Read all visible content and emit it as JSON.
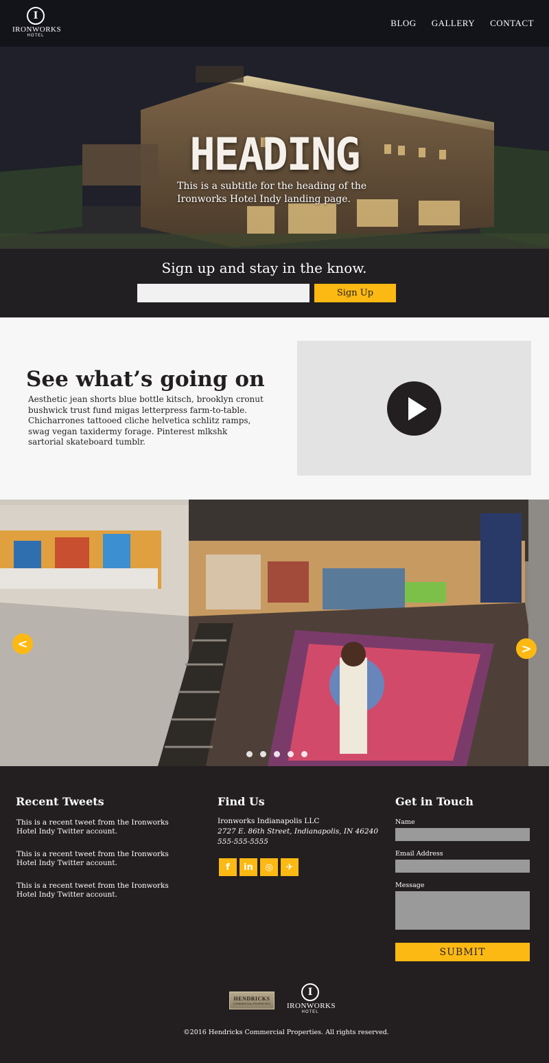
{
  "header": {
    "logo": {
      "name": "IRONWORKS",
      "sub": "HOTEL",
      "badge": "I"
    },
    "nav": [
      "BLOG",
      "GALLERY",
      "CONTACT"
    ]
  },
  "hero": {
    "heading": "HEADING",
    "subtitle": "This is a subtitle for the heading of the Ironworks Hotel Indy landing page.",
    "signup_title": "Sign up and stay in the know.",
    "signup_input_value": "",
    "signup_button": "Sign Up"
  },
  "info": {
    "title": "See what’s going on",
    "text": "Aesthetic jean shorts blue bottle kitsch, brooklyn cronut bushwick trust fund migas letterpress farm-to-table. Chicharrones tattooed cliche helvetica schlitz ramps, swag vegan taxidermy forage. Pinterest mlkshk sartorial skateboard tumblr."
  },
  "carousel": {
    "prev_glyph": "<",
    "next_glyph": ">",
    "slide_count": 5,
    "active_slide": 3
  },
  "footer": {
    "tweets_title": "Recent Tweets",
    "tweets": [
      "This is a recent tweet from the Ironworks Hotel Indy Twitter account.",
      "This is a recent tweet from the Ironworks Hotel Indy Twitter account.",
      "This is a recent tweet from the Ironworks Hotel Indy Twitter account."
    ],
    "find_title": "Find Us",
    "company": "Ironworks Indianapolis LLC",
    "address": "2727 E. 86th Street, Indianapolis, IN 46240",
    "phone": "555-555-5555",
    "socials": [
      {
        "name": "facebook-icon",
        "glyph": "f"
      },
      {
        "name": "linkedin-icon",
        "glyph": "in"
      },
      {
        "name": "instagram-icon",
        "glyph": "◎"
      },
      {
        "name": "twitter-icon",
        "glyph": "✈"
      }
    ],
    "contact_title": "Get in Touch",
    "name_label": "Name",
    "email_label": "Email Address",
    "message_label": "Message",
    "submit": "SUBMIT",
    "partner": {
      "name": "HENDRICKS",
      "sub": "COMMERCIAL PROPERTIES"
    },
    "logo": {
      "name": "IRONWORKS",
      "sub": "HOTEL",
      "badge": "I"
    },
    "copyright": "©2016 Hendricks Commercial Properties. All rights reserved."
  },
  "colors": {
    "accent": "#fdb913",
    "dark": "#231f20",
    "light_bg": "#f7f7f7",
    "video_bg": "#e4e3e4",
    "field": "#9a9a9a"
  }
}
